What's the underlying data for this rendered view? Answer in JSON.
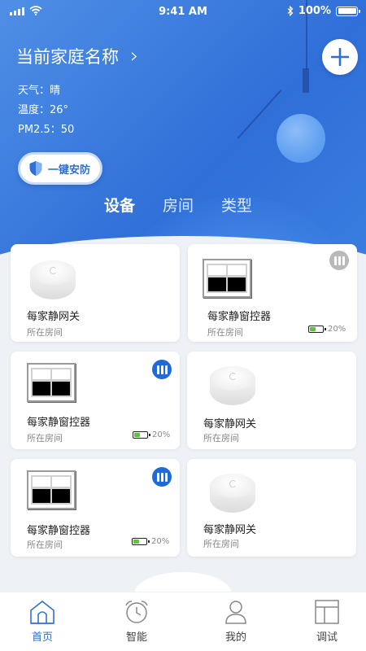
{
  "status_bar": {
    "time": "9:41 AM",
    "battery_percent": "100%"
  },
  "home": {
    "name": "当前家庭名称",
    "weather": "天气：晴",
    "temperature": "温度：26°",
    "pm25": "PM2.5：50"
  },
  "security_button": {
    "label": "一键安防"
  },
  "tabs": [
    {
      "label": "设备",
      "active": true
    },
    {
      "label": "房间",
      "active": false
    },
    {
      "label": "类型",
      "active": false
    }
  ],
  "devices": [
    {
      "type": "gateway",
      "name": "每家静网关",
      "room": "所在房间"
    },
    {
      "type": "window",
      "name": "每家静窗控器",
      "room": "所在房间",
      "battery": "20%",
      "battery_level": 0.2,
      "mode_badge": "gray"
    },
    {
      "type": "window",
      "name": "每家静窗控器",
      "room": "所在房间",
      "battery": "20%",
      "battery_level": 0.2,
      "mode_badge": "blue"
    },
    {
      "type": "gateway",
      "name": "每家静网关",
      "room": "所在房间"
    },
    {
      "type": "window",
      "name": "每家静窗控器",
      "room": "所在房间",
      "battery": "20%",
      "battery_level": 0.2,
      "mode_badge": "blue"
    },
    {
      "type": "gateway",
      "name": "每家静网关",
      "room": "所在房间"
    }
  ],
  "tabbar": [
    {
      "label": "首页",
      "icon": "home-icon",
      "active": true
    },
    {
      "label": "智能",
      "icon": "alarm-clock-icon",
      "active": false
    },
    {
      "label": "我的",
      "icon": "user-icon",
      "active": false
    },
    {
      "label": "调试",
      "icon": "layout-icon",
      "active": false
    }
  ],
  "colors": {
    "primary": "#2f6fd8",
    "battery_green": "#5cc43a",
    "badge_blue": "#1f6ad6",
    "badge_gray": "#b9b9b9"
  }
}
